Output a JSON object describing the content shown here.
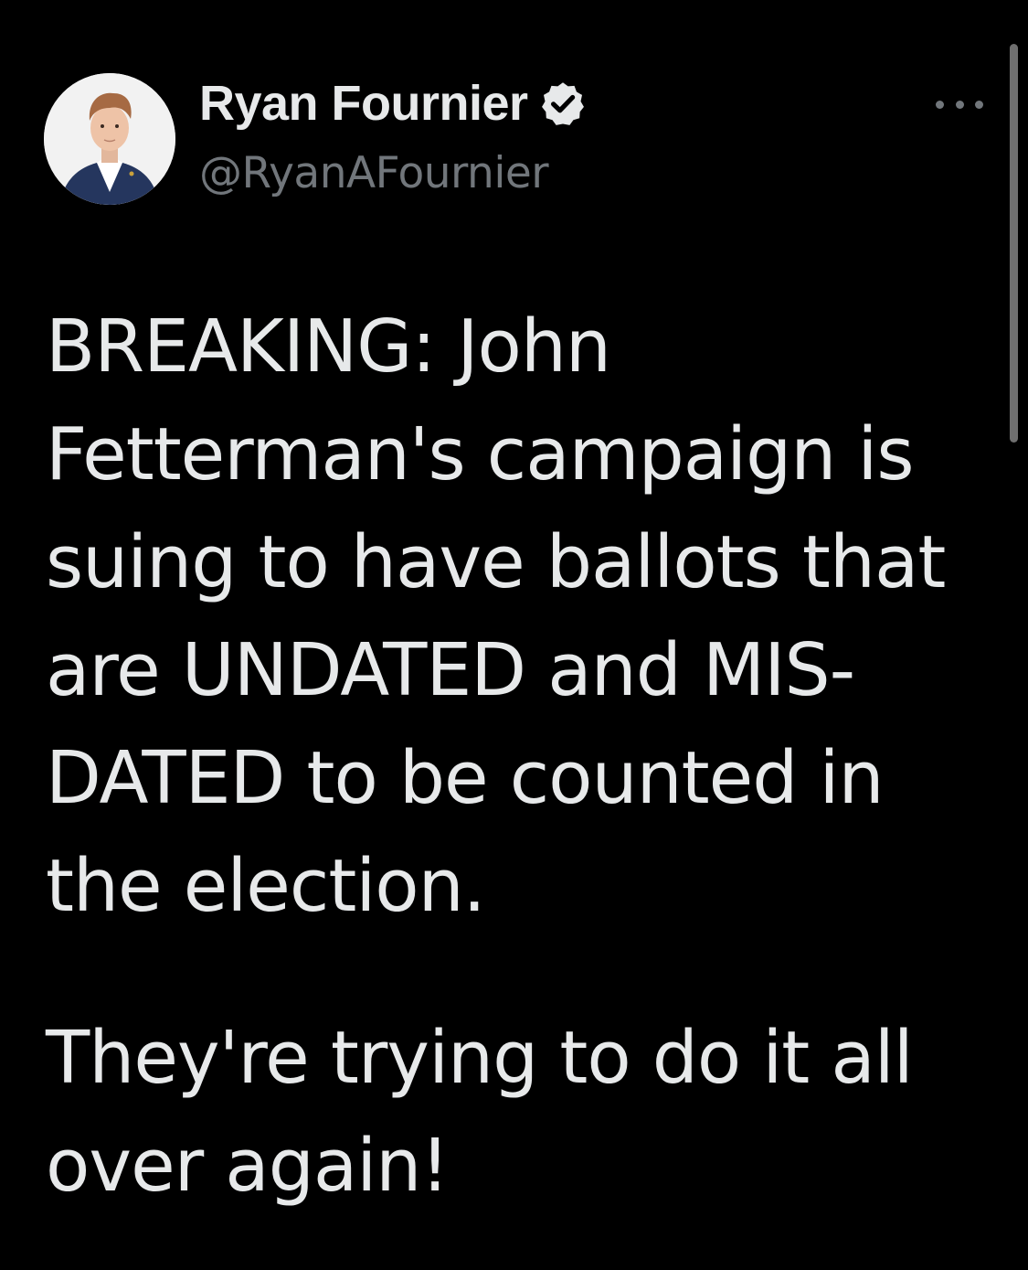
{
  "tweet": {
    "author": {
      "display_name": "Ryan Fournier",
      "handle": "@RyanAFournier",
      "verified_icon": "verified-badge-icon",
      "avatar_icon": "profile-photo"
    },
    "more_icon": "more-options-icon",
    "paragraphs": [
      "BREAKING: John Fetterman's campaign is suing to have ballots that are UNDATED and MIS-DATED to be counted in the election.",
      "They're trying to do it all over again!"
    ]
  },
  "colors": {
    "background": "#000000",
    "primary_text": "#e7e9ea",
    "secondary_text": "#71767b"
  }
}
